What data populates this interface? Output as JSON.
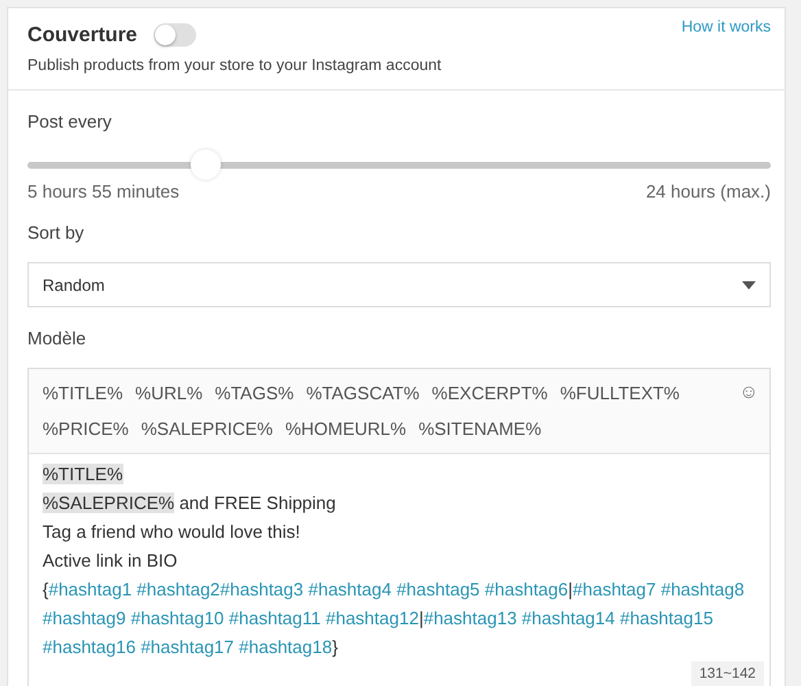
{
  "header": {
    "title": "Couverture",
    "enabled": false,
    "help_link": "How it works",
    "description": "Publish products from your store to your Instagram account"
  },
  "post_every": {
    "label": "Post every",
    "level": 0.24,
    "value": "5 hours 55 minutes",
    "max": "24 hours (max.)"
  },
  "sort_by": {
    "label": "Sort by",
    "value": "Random"
  },
  "template": {
    "label": "Modèle",
    "emoji_button": "☺",
    "variables": [
      "%TITLE%",
      "%URL%",
      "%TAGS%",
      "%TAGSCAT%",
      "%EXCERPT%",
      "%FULLTEXT%",
      "%PRICE%",
      "%SALEPRICE%",
      "%HOMEURL%",
      "%SITENAME%"
    ],
    "lines": [
      [
        {
          "kind": "variable",
          "text": "%TITLE%"
        }
      ],
      [
        {
          "kind": "variable",
          "text": "%SALEPRICE%"
        },
        {
          "kind": "text",
          "text": " and FREE Shipping"
        }
      ],
      [
        {
          "kind": "text",
          "text": "Tag a friend who would love this!"
        }
      ],
      [
        {
          "kind": "text",
          "text": "Active link in BIO"
        }
      ],
      [
        {
          "kind": "text",
          "text": "{"
        },
        {
          "kind": "hashtag",
          "text": "#hashtag1 #hashtag2#hashtag3 #hashtag4 #hashtag5 #hashtag6"
        },
        {
          "kind": "text",
          "text": "|"
        },
        {
          "kind": "hashtag",
          "text": "#hashtag7 #hashtag8 #hashtag9 #hashtag10 #hashtag11 #hashtag12"
        },
        {
          "kind": "text",
          "text": "|"
        },
        {
          "kind": "hashtag",
          "text": "#hashtag13 #hashtag14 #hashtag15 #hashtag16 #hashtag17 #hashtag18"
        },
        {
          "kind": "text",
          "text": "}"
        }
      ]
    ],
    "counter": "131~142"
  }
}
